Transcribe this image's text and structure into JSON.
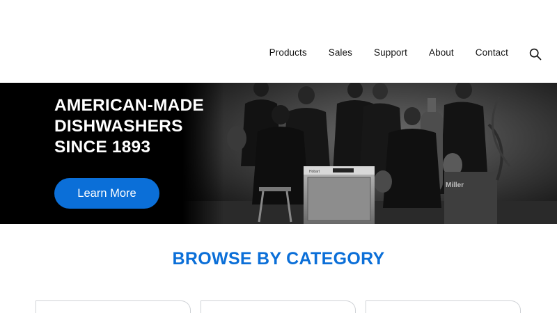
{
  "nav": {
    "items": [
      "Products",
      "Sales",
      "Support",
      "About",
      "Contact"
    ]
  },
  "icons": {
    "search": "search-icon"
  },
  "hero": {
    "title_lines": [
      "AMERICAN-MADE",
      "DISHWASHERS",
      "SINCE 1893"
    ],
    "cta_label": "Learn More",
    "dishwasher_brand": "Hobart",
    "machine_label": "Miller"
  },
  "browse": {
    "title": "BROWSE BY CATEGORY",
    "cards": [
      "",
      "",
      ""
    ]
  },
  "colors": {
    "accent": "#0b6fd8",
    "hero_bg": "#000000",
    "text": "#111111"
  }
}
